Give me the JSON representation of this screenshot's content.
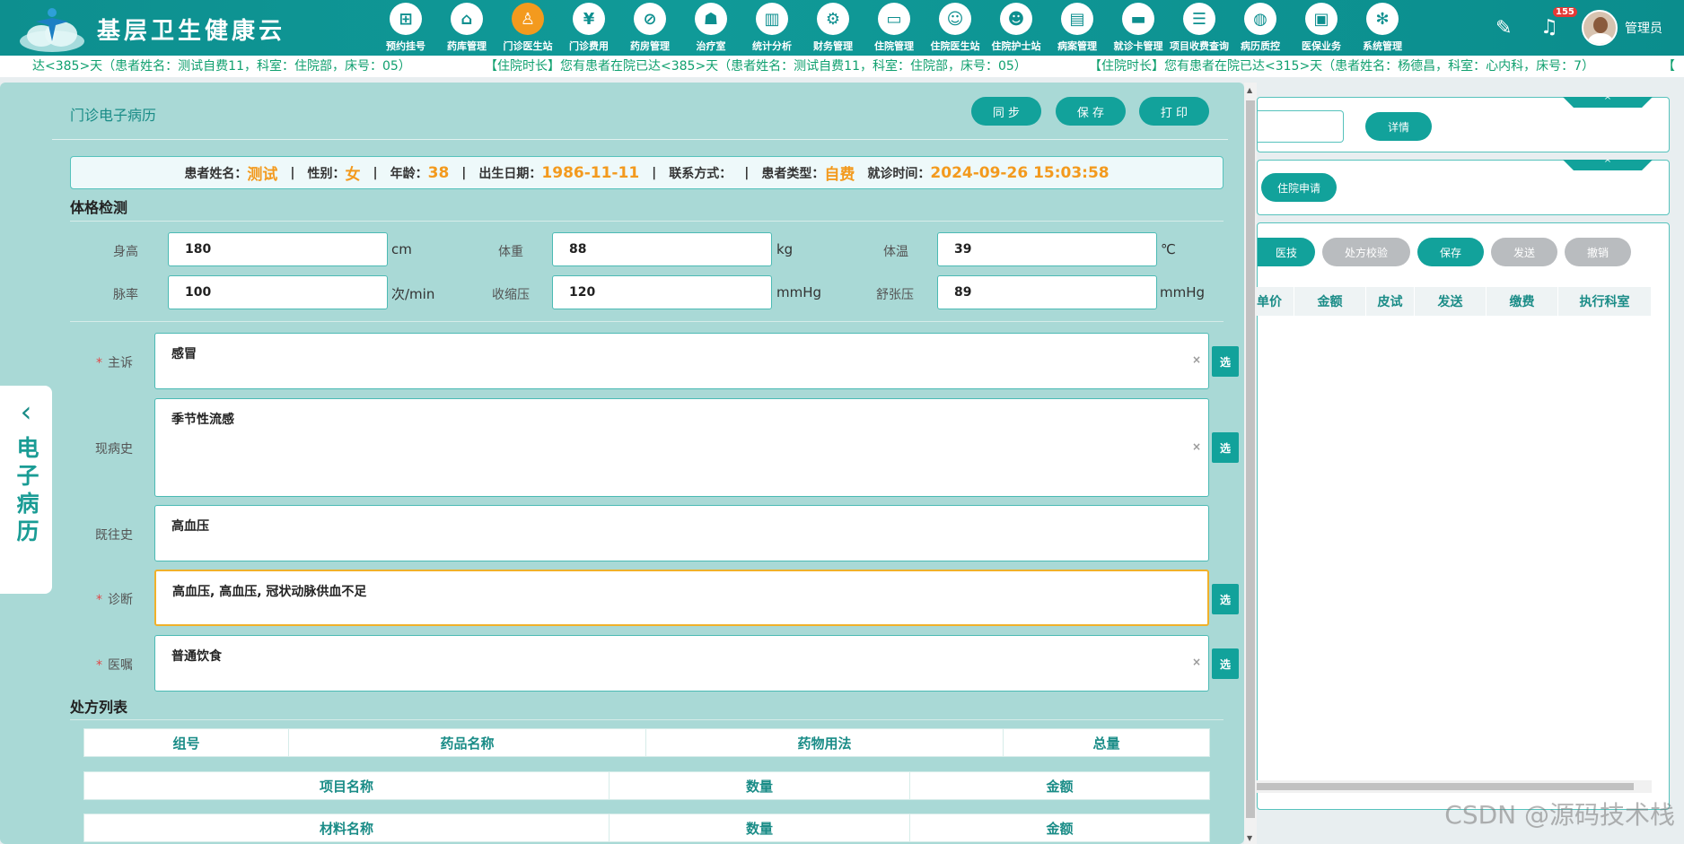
{
  "app": {
    "brand": "基层卫生健康云",
    "colors": {
      "teal": "#0d8f8f",
      "accent": "#f39a1e"
    }
  },
  "nav": [
    {
      "label": "预约挂号",
      "icon": "calendar-icon"
    },
    {
      "label": "药库管理",
      "icon": "warehouse-icon"
    },
    {
      "label": "门诊医生站",
      "icon": "doctor-icon",
      "active": true
    },
    {
      "label": "门诊费用",
      "icon": "yuan-icon"
    },
    {
      "label": "药房管理",
      "icon": "pill-icon"
    },
    {
      "label": "治疗室",
      "icon": "nurse-icon"
    },
    {
      "label": "统计分析",
      "icon": "chart-icon"
    },
    {
      "label": "财务管理",
      "icon": "gear-money-icon"
    },
    {
      "label": "住院管理",
      "icon": "bed-icon"
    },
    {
      "label": "住院医生站",
      "icon": "doctor-card-icon"
    },
    {
      "label": "住院护士站",
      "icon": "nurse-card-icon"
    },
    {
      "label": "病案管理",
      "icon": "record-icon"
    },
    {
      "label": "就诊卡管理",
      "icon": "card-icon"
    },
    {
      "label": "项目收费查询",
      "icon": "bill-icon"
    },
    {
      "label": "病历质控",
      "icon": "quality-icon"
    },
    {
      "label": "医保业务",
      "icon": "insurance-icon"
    },
    {
      "label": "系统管理",
      "icon": "settings-icon"
    }
  ],
  "header": {
    "notif_count": "155",
    "user": "管理员"
  },
  "ticker": {
    "items": [
      "达<385>天（患者姓名：测试自费11，科室：住院部，床号：05）",
      "【住院时长】您有患者在院已达<385>天（患者姓名：测试自费11，科室：住院部，床号：05）",
      "【住院时长】您有患者在院已达<315>天（患者姓名：杨德昌，科室：心内科，床号：7）",
      "【"
    ]
  },
  "modal": {
    "title": "门诊电子病历",
    "buttons": {
      "sync": "同 步",
      "save": "保 存",
      "print": "打 印"
    },
    "patient": {
      "name_label": "患者姓名：",
      "name": "测试",
      "sex_label": "性别：",
      "sex": "女",
      "age_label": "年龄：",
      "age": "38",
      "dob_label": "出生日期：",
      "dob": "1986-11-11",
      "contact_label": "联系方式：",
      "type_label": "患者类型：",
      "type": "自费",
      "time_label": "就诊时间：",
      "time": "2024-09-26 15:03:58",
      "sep": "|"
    },
    "exam": {
      "title": "体格检测",
      "height_label": "身高",
      "height": "180",
      "height_unit": "cm",
      "weight_label": "体重",
      "weight": "88",
      "weight_unit": "kg",
      "temp_label": "体温",
      "temp": "39",
      "temp_unit": "℃",
      "pulse_label": "脉率",
      "pulse": "100",
      "pulse_unit": "次/min",
      "sys_label": "收缩压",
      "sys": "120",
      "sys_unit": "mmHg",
      "dia_label": "舒张压",
      "dia": "89",
      "dia_unit": "mmHg"
    },
    "record": {
      "complaint_label": "主诉",
      "complaint": "感冒",
      "present_label": "现病史",
      "present": "季节性流感",
      "past_label": "既往史",
      "past": "高血压",
      "diagnosis_label": "诊断",
      "diagnosis": "高血压, 高血压, 冠状动脉供血不足",
      "advice_label": "医嘱",
      "advice": "普通饮食",
      "req": "*",
      "select": "选",
      "clear": "×"
    },
    "prescriptions": {
      "title": "处方列表",
      "drug_cols": [
        "组号",
        "药品名称",
        "药物用法",
        "总量"
      ],
      "item_cols": [
        "项目名称",
        "数量",
        "金额"
      ],
      "material_cols": [
        "材料名称",
        "数量",
        "金额"
      ]
    },
    "side_tab": {
      "arrow": "‹",
      "label": "电子病历"
    }
  },
  "background": {
    "detail_btn": "详情",
    "inpatient_btn": "住院申请",
    "action_btns": [
      "医技",
      "处方校验",
      "保存",
      "发送",
      "撤销"
    ],
    "grid_cols": [
      "单价",
      "金额",
      "皮试",
      "发送",
      "缴费",
      "执行科室"
    ],
    "collapse": "^",
    "watermark": "CSDN @源码技术栈"
  }
}
